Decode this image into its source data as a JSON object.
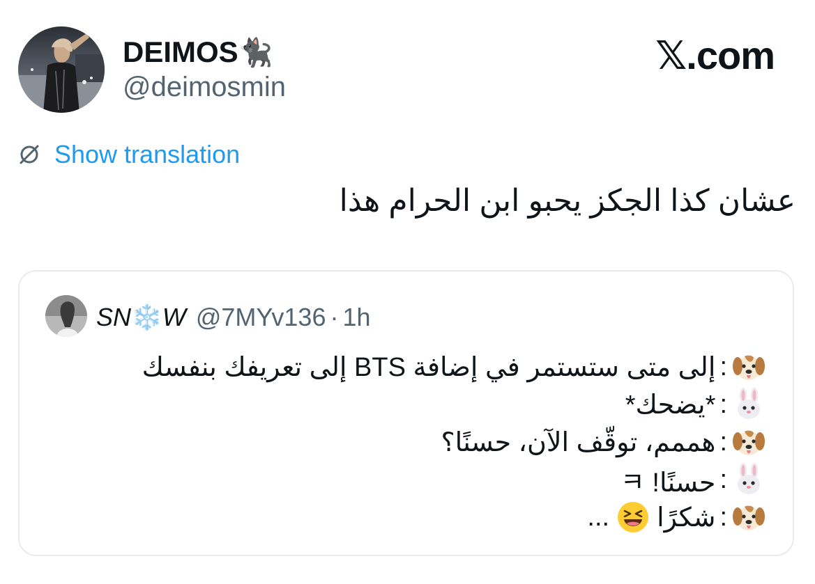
{
  "author": {
    "display_name": "DEIMOS",
    "name_emoji": "🐈‍⬛",
    "handle": "@deimosmin"
  },
  "brand": {
    "x_glyph": "𝕏",
    "domain_text": ".com"
  },
  "translation": {
    "label": "Show translation",
    "icon": "globe-icon"
  },
  "tweet": {
    "text": "عشان كذا الجكز يحبو ابن الحرام هذا"
  },
  "quote": {
    "name_left": "SN",
    "name_emoji": "❄️",
    "name_right": "W",
    "handle": "@7MYv136",
    "separator": "·",
    "time": "1h",
    "lines": [
      {
        "speaker": "dog-face-icon",
        "colon": ":",
        "text": "إلى متى ستستمر في إضافة BTS إلى تعريفك بنفسك"
      },
      {
        "speaker": "rabbit-face-icon",
        "colon": ":",
        "text": "*يضحك*"
      },
      {
        "speaker": "dog-face-icon",
        "colon": ":",
        "text": "هممم، توقّف الآن، حسنًا؟"
      },
      {
        "speaker": "rabbit-face-icon",
        "colon": ":",
        "text": "حسنًا! ㅋ"
      },
      {
        "speaker": "dog-face-icon",
        "colon": ":",
        "text": "شكرًا",
        "trail_emoji": "laughing-face-icon",
        "suffix": "..."
      }
    ]
  },
  "colors": {
    "link_blue": "#1d9bf0",
    "secondary_text": "#536471",
    "card_border": "#e8ebed",
    "primary_text": "#0f1419"
  }
}
